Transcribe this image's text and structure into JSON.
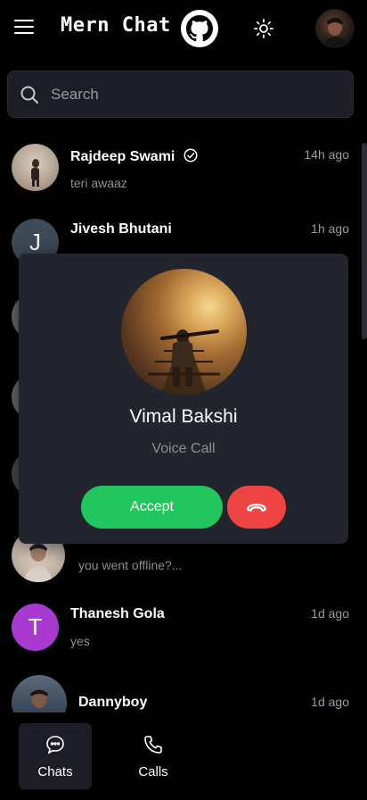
{
  "header": {
    "app_title": "Mern Chat",
    "menu_icon": "hamburger-menu-icon",
    "github_icon": "github-icon",
    "theme_icon": "sun-icon"
  },
  "search": {
    "placeholder": "Search",
    "value": ""
  },
  "chats": [
    {
      "name": "Rajdeep Swami",
      "verified": true,
      "time": "14h ago",
      "message": "teri awaaz",
      "avatar_initial": "",
      "avatar_color": "#8a7a6a"
    },
    {
      "name": "Jivesh Bhutani",
      "verified": false,
      "time": "1h ago",
      "message": "",
      "avatar_initial": "J",
      "avatar_color": "#3d4a57"
    },
    {
      "name": "",
      "verified": false,
      "time": "",
      "message": "",
      "avatar_initial": "",
      "avatar_color": "#6a6a6a"
    },
    {
      "name": "",
      "verified": false,
      "time": "",
      "message": "",
      "avatar_initial": "",
      "avatar_color": "#6a6a6a"
    },
    {
      "name": "",
      "verified": false,
      "time": "",
      "message": "",
      "avatar_initial": "",
      "avatar_color": "#5a5a5a"
    },
    {
      "name": "",
      "verified": false,
      "time": "",
      "message": "you went offline?...",
      "avatar_initial": "",
      "avatar_color": "#c8b8a8"
    },
    {
      "name": "Thanesh Gola",
      "verified": false,
      "time": "1d ago",
      "message": "yes",
      "avatar_initial": "T",
      "avatar_color": "#a83ad1"
    },
    {
      "name": "Dannyboy",
      "verified": false,
      "time": "1d ago",
      "message": "",
      "avatar_initial": "",
      "avatar_color": "#6a7a8a"
    }
  ],
  "call_modal": {
    "caller_name": "Vimal Bakshi",
    "call_type": "Voice Call",
    "accept_label": "Accept",
    "decline_icon": "phone-hangup-icon"
  },
  "bottom_nav": {
    "items": [
      {
        "label": "Chats",
        "icon": "chat-bubble-icon",
        "active": true
      },
      {
        "label": "Calls",
        "icon": "phone-icon",
        "active": false
      }
    ]
  },
  "colors": {
    "background": "#000000",
    "surface": "#22242e",
    "accept": "#22c55e",
    "decline": "#ef4444",
    "muted_text": "#8e8e96"
  }
}
